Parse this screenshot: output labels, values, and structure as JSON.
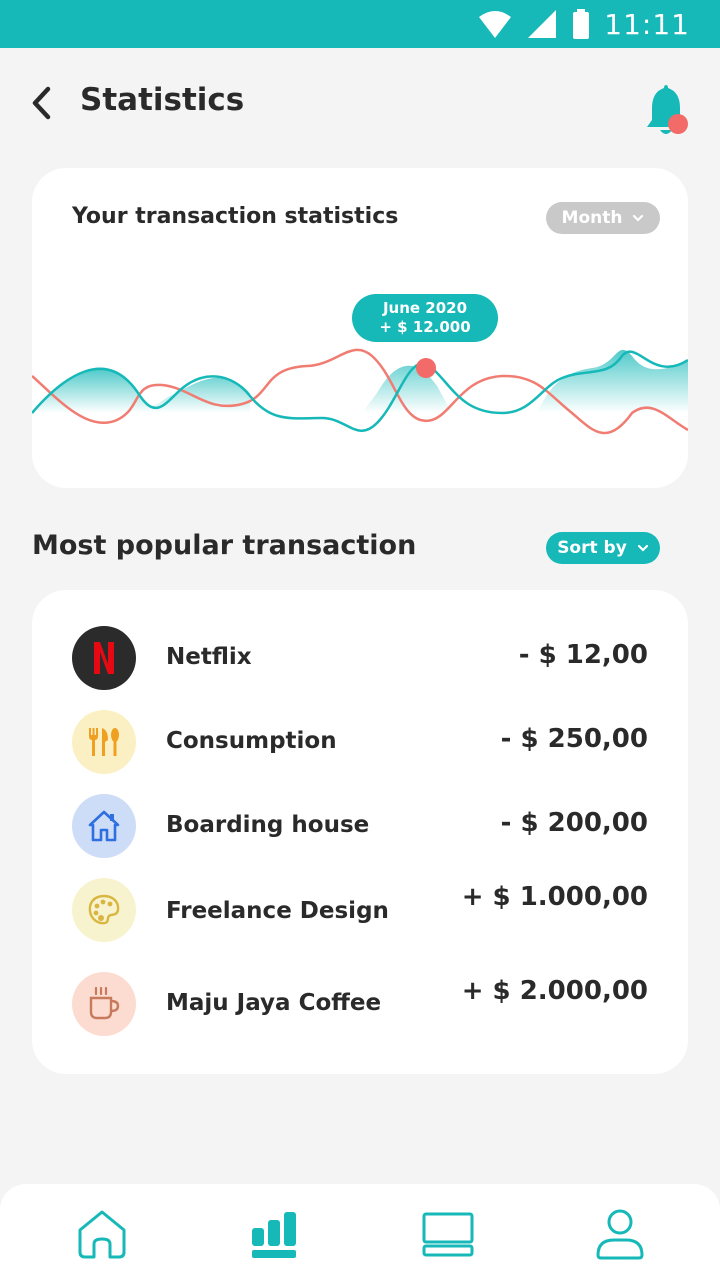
{
  "status_bar": {
    "time": "11:11"
  },
  "header": {
    "title": "Statistics"
  },
  "stats_card": {
    "title": "Your transaction statistics",
    "period": "Month",
    "tooltip": {
      "date": "June 2020",
      "amount": "+ $ 12.000"
    }
  },
  "popular": {
    "title": "Most popular transaction",
    "sort_label": "Sort by"
  },
  "transactions": [
    {
      "name": "Netflix",
      "amount": "- $ 12,00",
      "icon": "netflix-icon",
      "bg": "#2b2b2b"
    },
    {
      "name": "Consumption",
      "amount": "- $ 250,00",
      "icon": "cutlery-icon",
      "bg": "#fbf0c4"
    },
    {
      "name": "Boarding house",
      "amount": "- $ 200,00",
      "icon": "house-icon",
      "bg": "#cddcf7"
    },
    {
      "name": "Freelance Design",
      "amount": "+ $ 1.000,00",
      "icon": "palette-icon",
      "bg": "#f8f3cf"
    },
    {
      "name": "Maju Jaya Coffee",
      "amount": "+ $ 2.000,00",
      "icon": "coffee-icon",
      "bg": "#fcdcd1"
    }
  ],
  "nav": [
    {
      "name": "home-icon"
    },
    {
      "name": "statistics-icon",
      "active": true
    },
    {
      "name": "cards-icon"
    },
    {
      "name": "profile-icon"
    }
  ],
  "colors": {
    "accent": "#16b8b8",
    "expense_line": "#f07c72",
    "notification_dot": "#f26b68"
  }
}
